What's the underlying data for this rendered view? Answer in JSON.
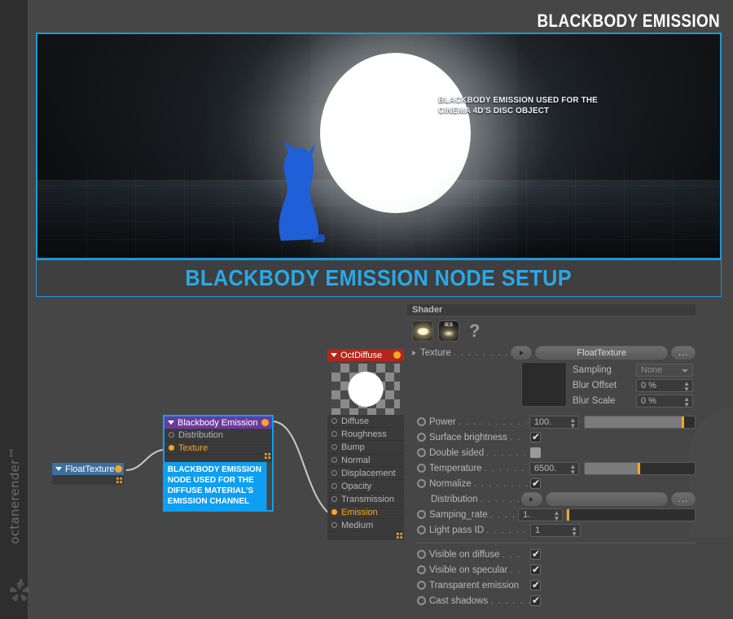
{
  "page": {
    "title": "BLACKBODY EMISSION",
    "banner_title": "BLACKBODY EMISSION NODE SETUP",
    "watermark": "octanerender™",
    "bg_color": "#464646",
    "accent_color": "#29a8e8"
  },
  "hero": {
    "caption_line1": "BLACKBODY EMISSION USED FOR THE",
    "caption_line2": "CINEMA 4D'S DISC OBJECT"
  },
  "shader_panel": {
    "header": "Shader",
    "icons": [
      {
        "name": "blackbody-emission-icon",
        "label": ""
      },
      {
        "name": "ies-emission-icon",
        "label": "IES"
      }
    ],
    "help_glyph": "?",
    "texture": {
      "label": "Texture",
      "dots": ". . . . . . . . . . . .",
      "value": "FloatTexture",
      "more_label": "...",
      "sampling": {
        "label": "Sampling",
        "value": "None"
      },
      "blur_offset": {
        "label": "Blur Offset",
        "value": "0 %"
      },
      "blur_scale": {
        "label": "Blur Scale",
        "value": "0 %"
      }
    },
    "power": {
      "label": "Power",
      "dots": ". . . . . . . . . . . .",
      "value": "100.",
      "slider_fill": 88,
      "slider_mark": 88
    },
    "surface_brightness": {
      "label": "Surface brightness",
      "dots": ". .",
      "checked": true
    },
    "double_sided": {
      "label": "Double sided",
      "dots": ". . . . . . .",
      "checked": false
    },
    "temperature": {
      "label": "Temperature",
      "dots": ". . . . . . . .",
      "value": "6500.",
      "slider_fill": 48,
      "slider_mark": 48
    },
    "normalize": {
      "label": "Normalize",
      "dots": ". . . . . . . . . .",
      "checked": true
    },
    "distribution": {
      "label": "Distribution",
      "dots": ". . . . . . . .",
      "value": "",
      "more_label": "..."
    },
    "sampling_rate": {
      "label": "Samping_rate",
      "dots": ". . . . . .",
      "value": "1.",
      "slider_fill": 0,
      "slider_mark": 0
    },
    "light_pass_id": {
      "label": "Light pass ID",
      "dots": ". . . . . . .",
      "value": "1"
    },
    "visible_on_diffuse": {
      "label": "Visible on diffuse",
      "dots": ". . .",
      "checked": true
    },
    "visible_on_specular": {
      "label": "Visible on specular",
      "dots": ". .",
      "checked": true
    },
    "transparent_emission": {
      "label": "Transparent emission",
      "dots": "",
      "checked": true
    },
    "cast_shadows": {
      "label": "Cast shadows",
      "dots": ". . . . . .",
      "checked": true
    }
  },
  "nodes": {
    "oct_diffuse": {
      "title": "OctDiffuse",
      "header_color": "#b2261b",
      "ports": [
        {
          "label": "Diffuse",
          "active": false
        },
        {
          "label": "Roughness",
          "active": false
        },
        {
          "label": "Bump",
          "active": false
        },
        {
          "label": "Normal",
          "active": false
        },
        {
          "label": "Displacement",
          "active": false
        },
        {
          "label": "Opacity",
          "active": false
        },
        {
          "label": "Transmission",
          "active": false
        },
        {
          "label": "Emission",
          "active": true
        },
        {
          "label": "Medium",
          "active": false
        }
      ]
    },
    "blackbody_emission": {
      "title": "Blackbody Emission",
      "header_color": "#6b3a9e",
      "ports": [
        {
          "label": "Distribution",
          "active": false
        },
        {
          "label": "Texture",
          "active": true
        }
      ],
      "annotation": [
        "BLACKBODY EMISSION",
        "NODE USED FOR THE",
        "DIFFUSE MATERIAL'S",
        "EMISSION CHANNEL"
      ]
    },
    "float_texture": {
      "title": "FloatTexture",
      "header_color": "#3f6f9c"
    }
  }
}
